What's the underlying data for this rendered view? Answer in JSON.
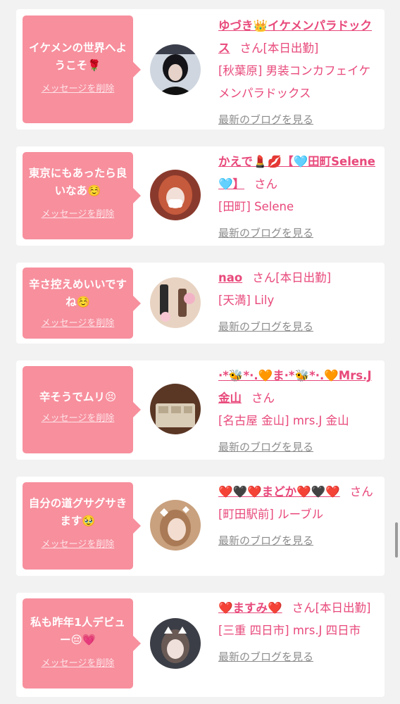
{
  "messages": [
    {
      "message": "イケメンの世界へようこそ🌹",
      "delete_label": "メッセージを削除",
      "name": "ゆづき👑イケメンパラドックス",
      "san_label": "さん[本日出勤]",
      "shop": "[秋葉原] 男装コンカフェイケメンパラドックス",
      "blog_label": "最新のブログを見る",
      "avatar_icon": "profile-photo-dark-hair"
    },
    {
      "message": "東京にもあったら良いなあ☺️",
      "delete_label": "メッセージを削除",
      "name": "かえで💄💋【🩵田町Selene🩵】",
      "san_label": "さん",
      "shop": "[田町] Selene",
      "blog_label": "最新のブログを見る",
      "avatar_icon": "profile-photo-masked"
    },
    {
      "message": "辛さ控えめいいですね☺️",
      "delete_label": "メッセージを削除",
      "name": "nao",
      "san_label": "さん[本日出勤]",
      "shop": "[天満] Lily",
      "blog_label": "最新のブログを見る",
      "avatar_icon": "profile-photo-drinks"
    },
    {
      "message": "辛そうでムリ😣",
      "delete_label": "メッセージを削除",
      "name": "·*🐝*·.🧡ま·*🐝*·.🧡Mrs.J金山",
      "san_label": "さん",
      "shop": "[名古屋 金山] mrs.J 金山",
      "blog_label": "最新のブログを見る",
      "avatar_icon": "profile-photo-cards"
    },
    {
      "message": "自分の道グサグサきます🥹",
      "delete_label": "メッセージを削除",
      "name": "❤️🖤❤️まどか❤️🖤❤️",
      "san_label": "さん",
      "shop": "[町田駅前] ルーブル",
      "blog_label": "最新のブログを見る",
      "avatar_icon": "profile-photo-light-hair"
    },
    {
      "message": "私も昨年1人デビュー😔💗",
      "delete_label": "メッセージを削除",
      "name": "❤️ますみ❤️",
      "san_label": "さん[本日出勤]",
      "shop": "[三重 四日市] mrs.J 四日市",
      "blog_label": "最新のブログを見る",
      "avatar_icon": "profile-photo-cat-filter"
    }
  ],
  "colors": {
    "accent": "#e8497b",
    "bubble": "#f78f9d",
    "background": "#f2f2f2"
  }
}
